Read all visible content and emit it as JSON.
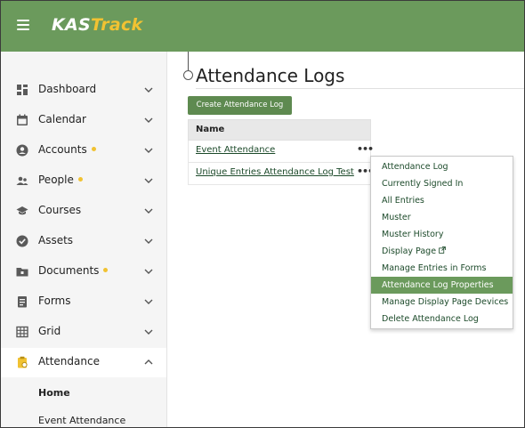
{
  "app": {
    "logo_kas": "KAS",
    "logo_track": "Track"
  },
  "sidebar": {
    "items": [
      {
        "label": "Dashboard",
        "icon": "dashboard-icon",
        "dot": false,
        "expanded": false
      },
      {
        "label": "Calendar",
        "icon": "calendar-icon",
        "dot": false,
        "expanded": false
      },
      {
        "label": "Accounts",
        "icon": "account-icon",
        "dot": true,
        "expanded": false
      },
      {
        "label": "People",
        "icon": "people-icon",
        "dot": true,
        "expanded": false
      },
      {
        "label": "Courses",
        "icon": "graduation-cap-icon",
        "dot": false,
        "expanded": false
      },
      {
        "label": "Assets",
        "icon": "check-circle-icon",
        "dot": false,
        "expanded": false
      },
      {
        "label": "Documents",
        "icon": "folder-icon",
        "dot": true,
        "expanded": false
      },
      {
        "label": "Forms",
        "icon": "form-icon",
        "dot": false,
        "expanded": false
      },
      {
        "label": "Grid",
        "icon": "grid-icon",
        "dot": false,
        "expanded": false
      },
      {
        "label": "Attendance",
        "icon": "clipboard-icon",
        "dot": false,
        "expanded": true
      }
    ],
    "sub_items": [
      {
        "label": "Home",
        "active": true
      },
      {
        "label": "Event Attendance",
        "active": false
      }
    ]
  },
  "main": {
    "title": "Attendance Logs",
    "create_button": "Create Attendance Log",
    "table": {
      "header": "Name",
      "rows": [
        {
          "name": "Event Attendance",
          "more": "•••"
        },
        {
          "name": "Unique Entries Attendance Log Test",
          "more": "•••"
        }
      ]
    }
  },
  "context_menu": {
    "items": [
      "Attendance Log",
      "Currently Signed In",
      "All Entries",
      "Muster",
      "Muster History",
      "Display Page",
      "Manage Entries in Forms",
      "Attendance Log Properties",
      "Manage Display Page Devices",
      "Delete Attendance Log"
    ],
    "active_item": "Attendance Log Properties"
  },
  "colors": {
    "header_green": "#6b9a5c",
    "button_green": "#5e8a50",
    "accent_yellow": "#f1c232",
    "link_green": "#1c4a2a"
  }
}
